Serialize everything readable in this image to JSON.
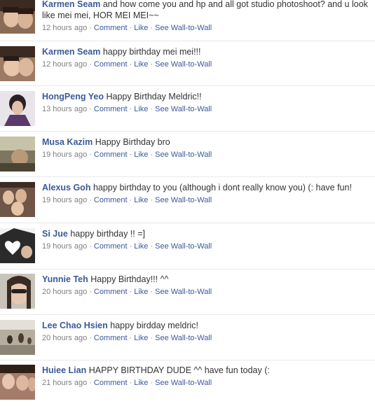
{
  "wall": {
    "posts": [
      {
        "author": "Karmen Seam",
        "message": "and how come you and hp and all got studio photoshoot? and u look like mei mei, HOR MEI MEI~~",
        "time": "12 hours ago",
        "comment": "Comment",
        "like": "Like",
        "wall_to_wall": "See Wall-to-Wall",
        "avatar_bg": "#8a6b58"
      },
      {
        "author": "Karmen Seam",
        "message": "happy birthday mei mei!!!",
        "time": "12 hours ago",
        "comment": "Comment",
        "like": "Like",
        "wall_to_wall": "See Wall-to-Wall",
        "avatar_bg": "#9c7a64"
      },
      {
        "author": "HongPeng Yeo",
        "message": "Happy Birthday Meldric!!",
        "time": "13 hours ago",
        "comment": "Comment",
        "like": "Like",
        "wall_to_wall": "See Wall-to-Wall",
        "avatar_bg": "#e8e4ea"
      },
      {
        "author": "Musa Kazim",
        "message": "Happy Birthday bro",
        "time": "19 hours ago",
        "comment": "Comment",
        "like": "Like",
        "wall_to_wall": "See Wall-to-Wall",
        "avatar_bg": "#7d7660"
      },
      {
        "author": "Alexus Goh",
        "message": "happy birthday to you (although i dont really know you) (: have fun!",
        "time": "19 hours ago",
        "comment": "Comment",
        "like": "Like",
        "wall_to_wall": "See Wall-to-Wall",
        "avatar_bg": "#6f5646"
      },
      {
        "author": "Si Jue",
        "message": "happy birthday !! =]",
        "time": "19 hours ago",
        "comment": "Comment",
        "like": "Like",
        "wall_to_wall": "See Wall-to-Wall",
        "avatar_bg": "#2a2a2a"
      },
      {
        "author": "Yunnie Teh",
        "message": "Happy Birthday!!! ^^",
        "time": "20 hours ago",
        "comment": "Comment",
        "like": "Like",
        "wall_to_wall": "See Wall-to-Wall",
        "avatar_bg": "#c9c4bb"
      },
      {
        "author": "Lee Chao Hsien",
        "message": "happy birdday meldric!",
        "time": "20 hours ago",
        "comment": "Comment",
        "like": "Like",
        "wall_to_wall": "See Wall-to-Wall",
        "avatar_bg": "#b5ad9e"
      },
      {
        "author": "Huiee Lian",
        "message": "HAPPY BIRTHDAY DUDE ^^ have fun today (:",
        "time": "21 hours ago",
        "comment": "Comment",
        "like": "Like",
        "wall_to_wall": "See Wall-to-Wall",
        "avatar_bg": "#a57c6c"
      }
    ]
  },
  "colors": {
    "link": "#3b5998",
    "meta": "#808080",
    "divider": "#e9e9e9"
  }
}
